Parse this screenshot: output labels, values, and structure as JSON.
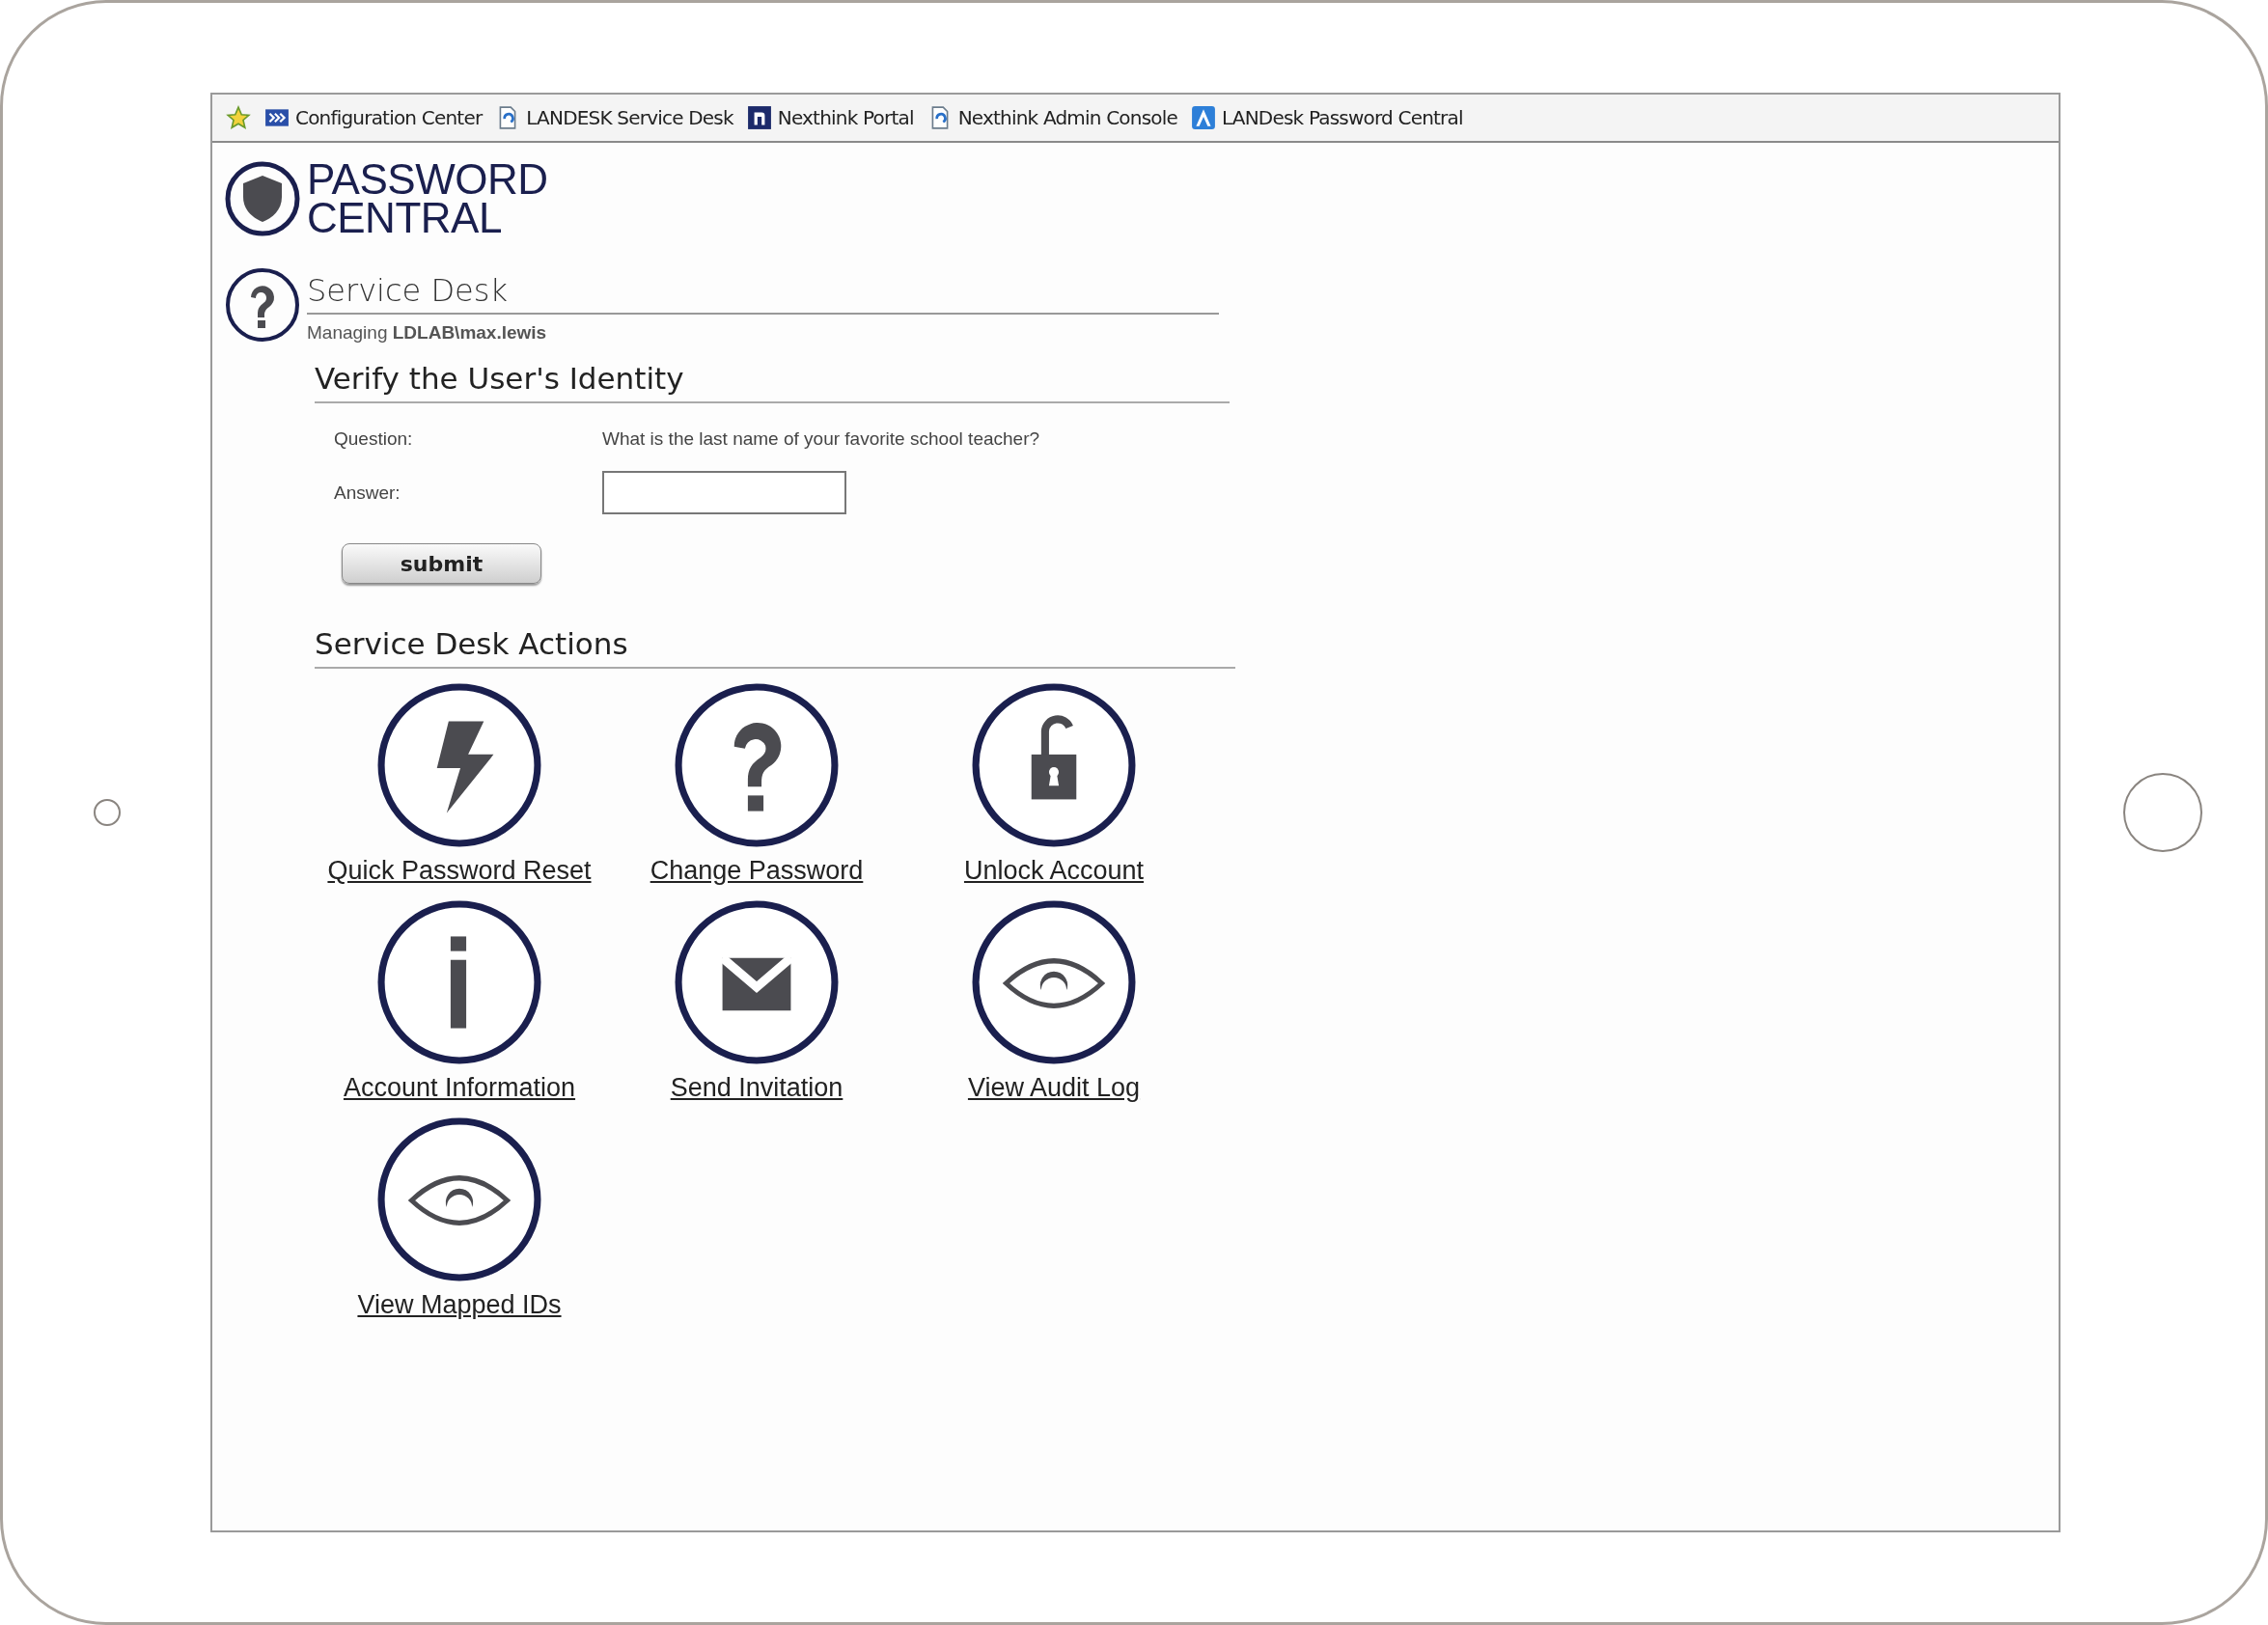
{
  "bookmarks": [
    {
      "kind": "star"
    },
    {
      "kind": "arrows",
      "label": "Configuration Center"
    },
    {
      "kind": "page",
      "label": "LANDESK Service Desk"
    },
    {
      "kind": "arch",
      "label": "Nexthink Portal"
    },
    {
      "kind": "page",
      "label": "Nexthink Admin Console"
    },
    {
      "kind": "peak",
      "label": "LANDesk Password Central"
    }
  ],
  "logo": {
    "lines": [
      "PASSWORD",
      "CENTRAL"
    ]
  },
  "section": {
    "title": "Service Desk",
    "managing": "Managing **LDLAB\\max.lewis**"
  },
  "verify": {
    "title": "Verify the User's Identity",
    "question_label": "Question:",
    "question": "What is the last name of your favorite school teacher?",
    "answer_label": "Answer:",
    "submit": "submit"
  },
  "actions": {
    "title": "Service Desk Actions",
    "items": [
      {
        "kind": "bolt",
        "label": "Quick Password Reset"
      },
      {
        "kind": "question",
        "label": "Change Password"
      },
      {
        "kind": "unlock",
        "label": "Unlock Account"
      },
      {
        "kind": "info",
        "label": "Account Information"
      },
      {
        "kind": "mail",
        "label": "Send Invitation"
      },
      {
        "kind": "eye",
        "label": "View Audit Log"
      },
      {
        "kind": "eye",
        "label": "View Mapped IDs"
      }
    ]
  }
}
